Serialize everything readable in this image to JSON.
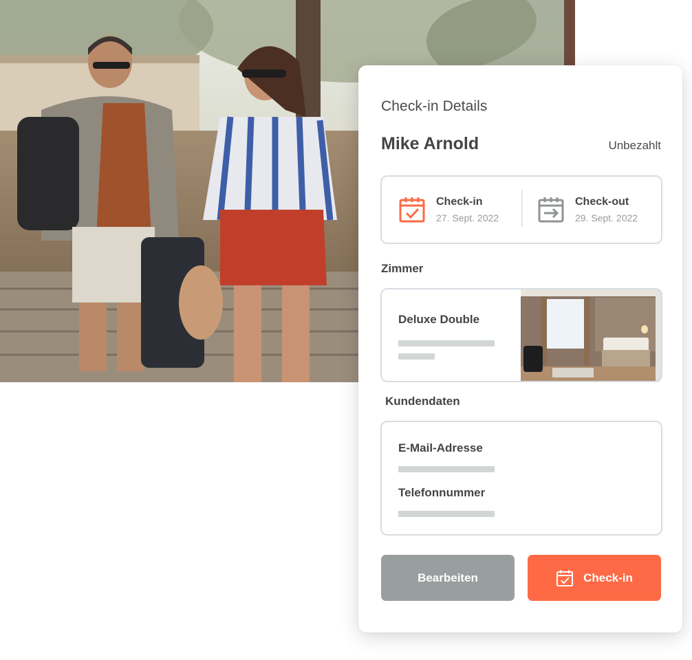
{
  "photo": {
    "subject": "couple-with-luggage-photo"
  },
  "card": {
    "title": "Check-in Details",
    "guest_name": "Mike Arnold",
    "payment_status": "Unbezahlt"
  },
  "dates": {
    "checkin": {
      "label": "Check-in",
      "date": "27. Sept. 2022",
      "icon": "calendar-check-icon"
    },
    "checkout": {
      "label": "Check-out",
      "date": "29. Sept. 2022",
      "icon": "calendar-arrow-icon"
    }
  },
  "room": {
    "section_label": "Zimmer",
    "name": "Deluxe Double",
    "image": "hotel-room-photo"
  },
  "customer": {
    "section_label": "Kundendaten",
    "email_label": "E-Mail-Adresse",
    "phone_label": "Telefonnummer"
  },
  "actions": {
    "edit_label": "Bearbeiten",
    "checkin_label": "Check-in",
    "checkin_icon": "calendar-check-icon"
  },
  "colors": {
    "accent": "#fd6a45",
    "secondary_button": "#999e9f",
    "text": "#444444",
    "muted_text": "#9a9a9a",
    "border": "#d7dde2",
    "skeleton": "#d3d6d6"
  }
}
